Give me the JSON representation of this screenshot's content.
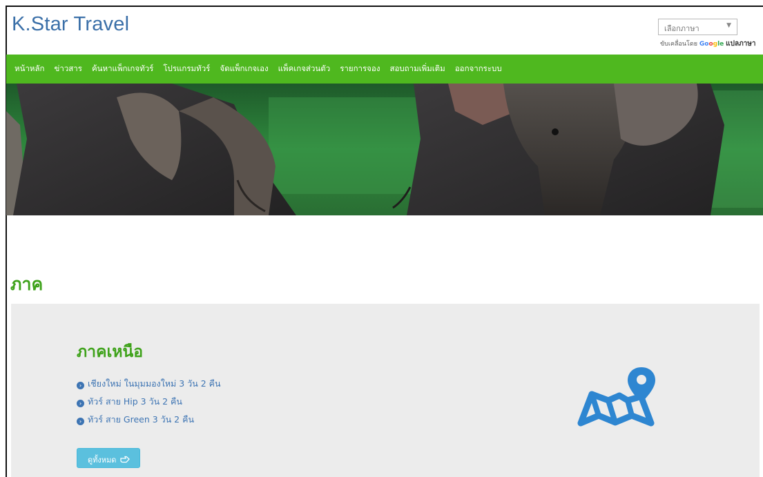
{
  "header": {
    "brand": "K.Star Travel",
    "language_select": {
      "value": "เลือกภาษา",
      "arrow": "▼"
    },
    "powered_by": {
      "prefix": "ขับเคลื่อนโดย",
      "google_letters": [
        "Go",
        "o",
        "g",
        "le"
      ],
      "translate": "แปลภาษา"
    }
  },
  "nav": {
    "items": [
      "หน้าหลัก",
      "ข่าวสาร",
      "ค้นหาแพ็กเกจทัวร์",
      "โปรแกรมทัวร์",
      "จัดแพ็กเกจเอง",
      "แพ็คเกจส่วนตัว",
      "รายการจอง",
      "สอบถามเพิ่มเติม",
      "ออกจากระบบ"
    ]
  },
  "section": {
    "title": "ภาค"
  },
  "region_card": {
    "title": "ภาคเหนือ",
    "tours": [
      "เชียงใหม่ ในมุมมองใหม่ 3 วัน 2 คืน",
      "ทัวร์ สาย Hip 3 วัน 2 คืน",
      "ทัวร์ สาย Green 3 วัน 2 คืน"
    ],
    "bullet_glyph": "›",
    "view_all_label": "ดูทั้งหมด",
    "view_all_icon": "hand-pointing-right-icon",
    "map_icon": "map-pin-icon"
  },
  "colors": {
    "brand_blue": "#3a6fa8",
    "nav_green": "#4fb81f",
    "title_green": "#3ea21a",
    "link_blue": "#3d74b3",
    "button_cyan": "#5bc0de",
    "card_gray": "#ececec",
    "icon_blue": "#2e86d1"
  }
}
